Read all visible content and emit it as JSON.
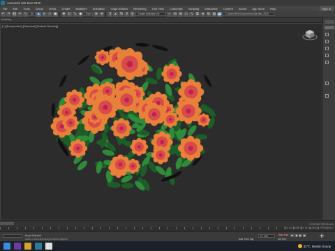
{
  "window": {
    "title": "Autodesk 3ds Max 2020"
  },
  "menu": {
    "items": [
      "File",
      "Edit",
      "Tools",
      "Group",
      "Views",
      "Create",
      "Modifiers",
      "Animation",
      "Graph Editors",
      "Rendering",
      "Civil View",
      "Customize",
      "Scripting",
      "Interactive",
      "Content",
      "Arnold",
      "App Store",
      "Help"
    ],
    "signin": "Sign In"
  },
  "toolbar": {
    "filter_value": "All",
    "view_value": "View",
    "selection_set": "Create Selection Se",
    "workspace_path": "C:\\Users\\Ehh\\Documents\\3ds Max 2020"
  },
  "ribbon": {
    "label": "Modeling"
  },
  "viewport": {
    "label": "[+] [Perspective] [Standard] [Default Shading]"
  },
  "statusbar": {
    "selected": "None Selected",
    "prompt": "Click or click-and-drag to select objects",
    "add_time_tag": "Add Time Tag",
    "frame": "0 / 100",
    "auto_key": "Auto Key",
    "set_key": "Set Key",
    "selected_dd": "Selected"
  },
  "activate": {
    "line1": "Activate Windows",
    "line2": "Go to Settings to activate Windows."
  },
  "taskbar": {
    "weather_temp": "32°C",
    "weather_text": "Mostly cloudy"
  },
  "colors": {
    "petal_outer": "#e8803a",
    "petal_inner": "#d84b4b",
    "petal_center": "#c02050",
    "leaf": "#2f8a3a",
    "leaf_dark": "#1d5e28"
  }
}
